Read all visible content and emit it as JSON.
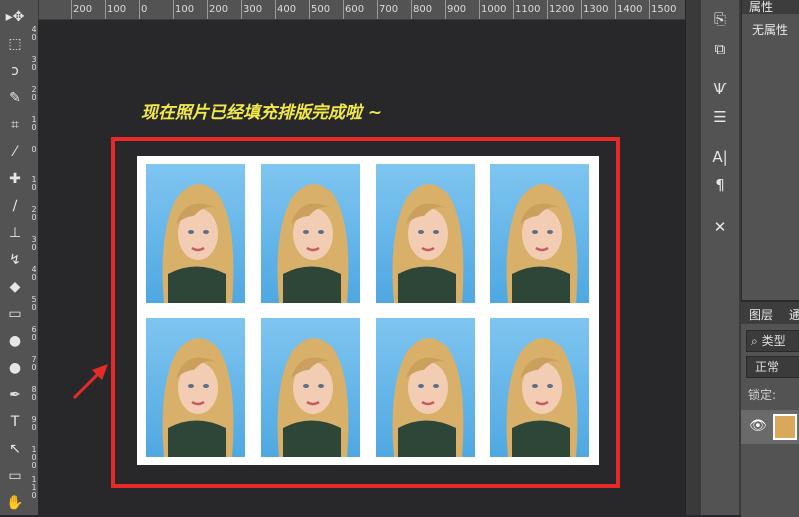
{
  "ruler": {
    "top_labels": [
      "200",
      "100",
      "0",
      "100",
      "200",
      "300",
      "400",
      "500",
      "600",
      "700",
      "800",
      "900",
      "1000",
      "1100",
      "1200",
      "1300",
      "1400",
      "1500"
    ],
    "left_labels": [
      "4\n0",
      "3\n0",
      "2\n0",
      "1\n0",
      "0",
      "1\n0",
      "2\n0",
      "3\n0",
      "4\n0",
      "5\n0",
      "6\n0",
      "7\n0",
      "8\n0",
      "9\n0",
      "1\n0\n0",
      "1\n1\n0"
    ]
  },
  "tools": [
    {
      "icon": "move-icon",
      "glyph": "▸✥"
    },
    {
      "icon": "marquee-icon",
      "glyph": "⬚"
    },
    {
      "icon": "lasso-icon",
      "glyph": "ↄ"
    },
    {
      "icon": "quick-select-icon",
      "glyph": "✎"
    },
    {
      "icon": "crop-icon",
      "glyph": "⌗"
    },
    {
      "icon": "eyedropper-icon",
      "glyph": "⁄"
    },
    {
      "icon": "healing-icon",
      "glyph": "✚"
    },
    {
      "icon": "brush-icon",
      "glyph": "∕"
    },
    {
      "icon": "stamp-icon",
      "glyph": "⊥"
    },
    {
      "icon": "history-brush-icon",
      "glyph": "↯"
    },
    {
      "icon": "eraser-icon",
      "glyph": "◆"
    },
    {
      "icon": "gradient-icon",
      "glyph": "▭"
    },
    {
      "icon": "blur-icon",
      "glyph": "●"
    },
    {
      "icon": "dodge-icon",
      "glyph": "●"
    },
    {
      "icon": "pen-icon",
      "glyph": "✒"
    },
    {
      "icon": "type-icon",
      "glyph": "T"
    },
    {
      "icon": "path-select-icon",
      "glyph": "↖"
    },
    {
      "icon": "shape-icon",
      "glyph": "▭"
    },
    {
      "icon": "hand-icon",
      "glyph": "✋"
    }
  ],
  "canvas": {
    "caption": "现在照片已经填充排版完成啦 ~",
    "photos_count": 8
  },
  "side_buttons": [
    {
      "icon": "history-icon",
      "glyph": "⎘"
    },
    {
      "icon": "actions-icon",
      "glyph": "⧉"
    },
    {
      "icon": "brushes-icon",
      "glyph": "Ѱ"
    },
    {
      "icon": "brush-settings-icon",
      "glyph": "☰"
    },
    {
      "icon": "character-icon",
      "glyph": "A|"
    },
    {
      "icon": "paragraph-icon",
      "glyph": "¶"
    },
    {
      "icon": "tool-presets-icon",
      "glyph": "✕"
    }
  ],
  "properties": {
    "tab": "属性",
    "empty_text": "无属性"
  },
  "layers": {
    "tab": "图层",
    "tab2": "通",
    "search_label": "类型",
    "blend_mode": "正常",
    "lock_label": "锁定:",
    "colors": {
      "frame": "#e62a2a",
      "caption": "#f1e94a"
    }
  }
}
